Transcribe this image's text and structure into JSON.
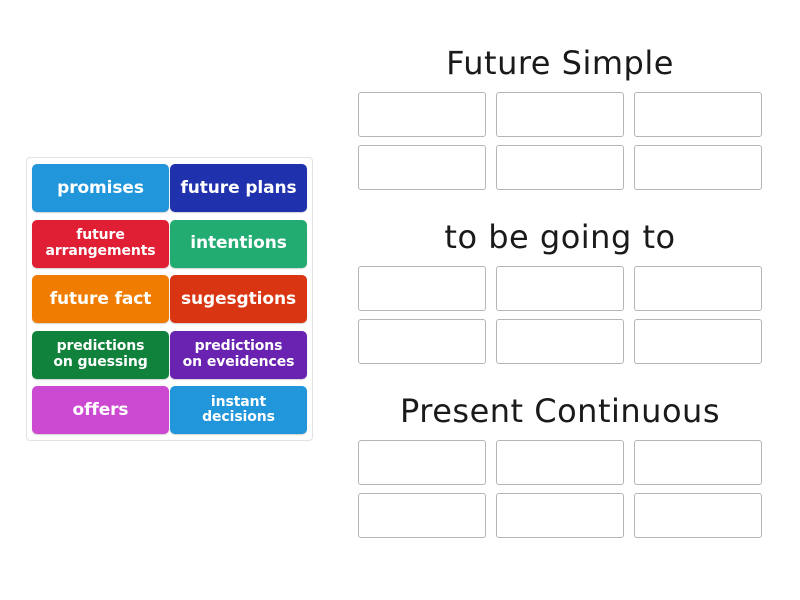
{
  "activity": {
    "type": "group-sort",
    "tiles_panel_label": "word tiles"
  },
  "tiles": [
    {
      "label": "promises",
      "color": "#2196da",
      "lines": 1
    },
    {
      "label": "future plans",
      "color": "#1f31ac",
      "lines": 1
    },
    {
      "label": "future\narrangements",
      "line1": "future",
      "line2": "arrangements",
      "color": "#e01f35",
      "lines": 2
    },
    {
      "label": "intentions",
      "color": "#22ac72",
      "lines": 1
    },
    {
      "label": "future fact",
      "color": "#f07d02",
      "lines": 1
    },
    {
      "label": "sugesgtions",
      "color": "#d93512",
      "lines": 1
    },
    {
      "label": "predictions\non guessing",
      "line1": "predictions",
      "line2": "on guessing",
      "color": "#10823c",
      "lines": 2
    },
    {
      "label": "predictions\non eveidences",
      "line1": "predictions",
      "line2": "on eveidences",
      "color": "#6a23b0",
      "lines": 2
    },
    {
      "label": "offers",
      "color": "#cc4ad2",
      "lines": 1
    },
    {
      "label": "instant\ndecisions",
      "line1": "instant",
      "line2": "decisions",
      "color": "#2196da",
      "lines": 2
    }
  ],
  "categories": [
    {
      "title": "Future Simple",
      "zones": [
        [
          "",
          "",
          ""
        ],
        [
          "",
          "",
          ""
        ]
      ]
    },
    {
      "title": "to be going to",
      "zones": [
        [
          "",
          "",
          ""
        ],
        [
          "",
          "",
          ""
        ]
      ]
    },
    {
      "title": "Present Continuous",
      "zones": [
        [
          "",
          "",
          ""
        ],
        [
          "",
          "",
          ""
        ]
      ]
    }
  ],
  "colors": {
    "background": "#ffffff",
    "panel_border": "#e2e2e2",
    "zone_border": "#b5b5b5",
    "title_text": "#1a1a1a",
    "tile_text": "#ffffff"
  }
}
